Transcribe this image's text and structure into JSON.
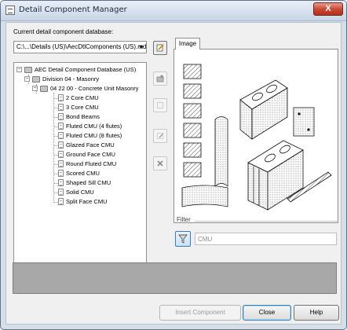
{
  "window": {
    "title": "Detail Component Manager",
    "close_glyph": "X"
  },
  "database": {
    "label": "Current detail component database:",
    "value": "C:\\...\\Details (US)\\AecDtlComponents (US).mdb"
  },
  "tree": {
    "root": "AEC Detail Component Database (US)",
    "division": "Division 04 - Masonry",
    "section": "04 22 00 - Concrete Unit Masonry",
    "items": [
      "2 Core CMU",
      "3 Core CMU",
      "Bond Beams",
      "Fluted CMU (4 flutes)",
      "Fluted CMU (8 flutes)",
      "Glazed Face CMU",
      "Ground Face CMU",
      "Round Fluted CMU",
      "Scored CMU",
      "Shaped Sill CMU",
      "Solid CMU",
      "Split Face CMU"
    ]
  },
  "side_buttons": [
    {
      "icon": "edit-database-icon"
    },
    {
      "icon": "new-folder-icon"
    },
    {
      "icon": "new-item-icon"
    },
    {
      "icon": "edit-item-icon"
    },
    {
      "icon": "delete-icon"
    }
  ],
  "image_tab": {
    "label": "Image"
  },
  "filter": {
    "label": "Filter",
    "value": "CMU",
    "icon": "filter-icon"
  },
  "buttons": {
    "insert": "Insert Component",
    "close": "Close",
    "help": "Help"
  },
  "colors": {
    "accent": "#3c7fb1",
    "close_red": "#c8452f"
  }
}
